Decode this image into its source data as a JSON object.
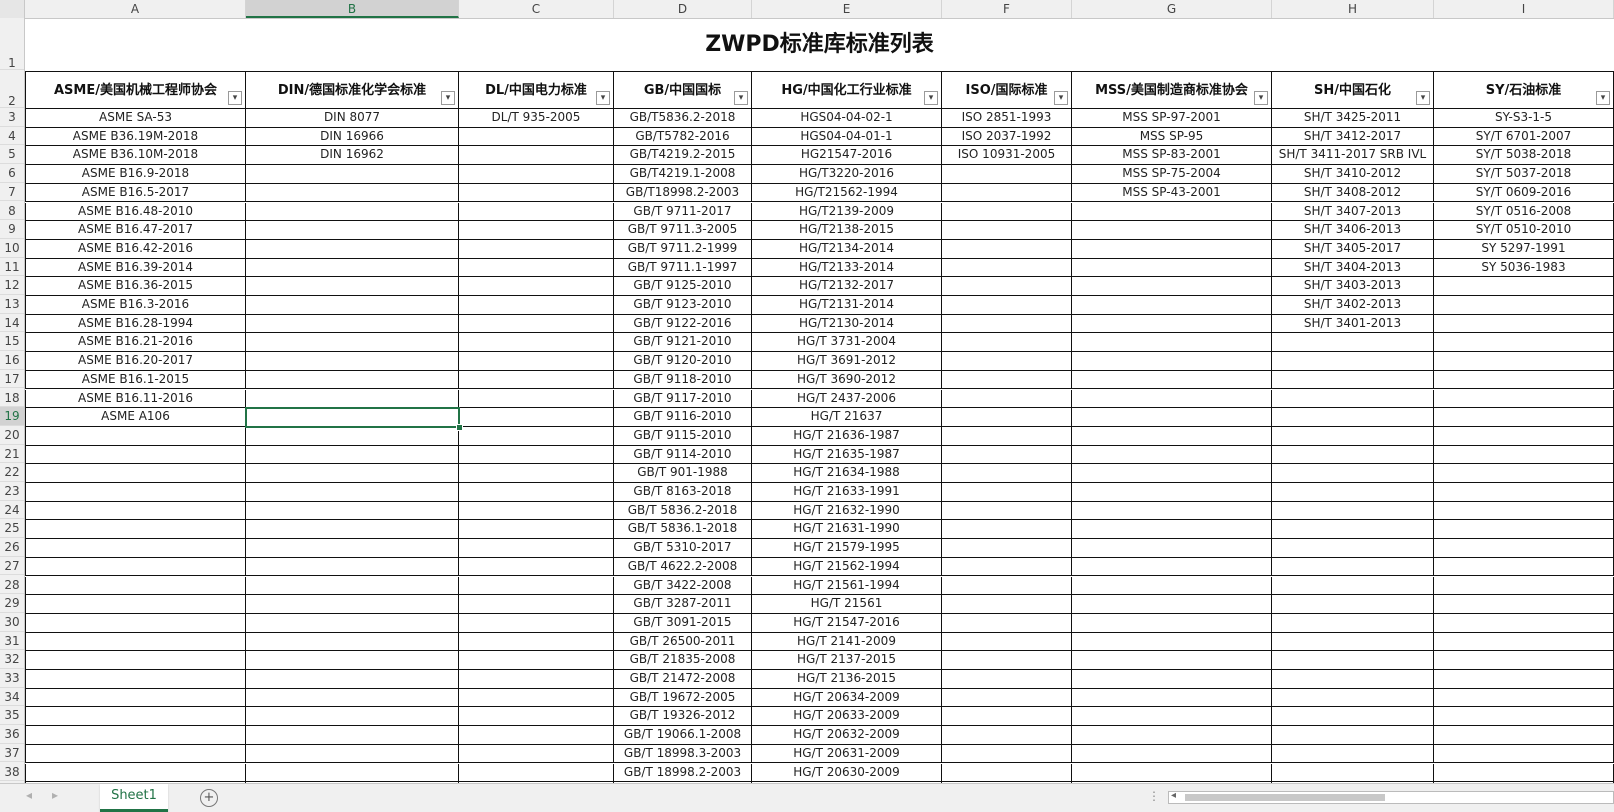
{
  "sheet": {
    "title": "ZWPD标准库标准列表",
    "col_letters": [
      "A",
      "B",
      "C",
      "D",
      "E",
      "F",
      "G",
      "H",
      "I"
    ],
    "selected_col": "B",
    "selected_row": 19,
    "row_numbers": [
      1,
      2,
      3,
      4,
      5,
      6,
      7,
      8,
      9,
      10,
      11,
      12,
      13,
      14,
      15,
      16,
      17,
      18,
      19,
      20,
      21,
      22,
      23,
      24,
      25,
      26,
      27,
      28,
      29,
      30,
      31,
      32,
      33,
      34,
      35,
      36,
      37,
      38
    ],
    "headers": [
      "ASME/美国机械工程师协会",
      "DIN/德国标准化学会标准",
      "DL/中国电力标准",
      "GB/中国国标",
      "HG/中国化工行业标准",
      "ISO/国际标准",
      "MSS/美国制造商标准协会",
      "SH/中国石化",
      "SY/石油标准"
    ],
    "columns": [
      [
        "ASME SA-53",
        "ASME B36.19M-2018",
        "ASME B36.10M-2018",
        "ASME B16.9-2018",
        "ASME B16.5-2017",
        "ASME B16.48-2010",
        "ASME B16.47-2017",
        "ASME B16.42-2016",
        "ASME B16.39-2014",
        "ASME B16.36-2015",
        "ASME B16.3-2016",
        "ASME B16.28-1994",
        "ASME B16.21-2016",
        "ASME B16.20-2017",
        "ASME B16.1-2015",
        "ASME B16.11-2016",
        "ASME A106"
      ],
      [
        "DIN 8077",
        "DIN 16966",
        "DIN 16962"
      ],
      [
        "DL/T 935-2005"
      ],
      [
        "GB/T5836.2-2018",
        "GB/T5782-2016",
        "GB/T4219.2-2015",
        "GB/T4219.1-2008",
        "GB/T18998.2-2003",
        "GB/T 9711-2017",
        "GB/T 9711.3-2005",
        "GB/T 9711.2-1999",
        "GB/T 9711.1-1997",
        "GB/T 9125-2010",
        "GB/T 9123-2010",
        "GB/T 9122-2016",
        "GB/T 9121-2010",
        "GB/T 9120-2010",
        "GB/T 9118-2010",
        "GB/T 9117-2010",
        "GB/T 9116-2010",
        "GB/T 9115-2010",
        "GB/T 9114-2010",
        "GB/T 901-1988",
        "GB/T 8163-2018",
        "GB/T 5836.2-2018",
        "GB/T 5836.1-2018",
        "GB/T 5310-2017",
        "GB/T 4622.2-2008",
        "GB/T 3422-2008",
        "GB/T 3287-2011",
        "GB/T 3091-2015",
        "GB/T 26500-2011",
        "GB/T 21835-2008",
        "GB/T 21472-2008",
        "GB/T 19672-2005",
        "GB/T 19326-2012",
        "GB/T 19066.1-2008",
        "GB/T 18998.3-2003",
        "GB/T 18998.2-2003"
      ],
      [
        "HGS04-04-02-1",
        "HGS04-04-01-1",
        "HG21547-2016",
        "HG/T3220-2016",
        "HG/T21562-1994",
        "HG/T2139-2009",
        "HG/T2138-2015",
        "HG/T2134-2014",
        "HG/T2133-2014",
        "HG/T2132-2017",
        "HG/T2131-2014",
        "HG/T2130-2014",
        "HG/T 3731-2004",
        "HG/T 3691-2012",
        "HG/T 3690-2012",
        "HG/T 2437-2006",
        "HG/T 21637",
        "HG/T 21636-1987",
        "HG/T 21635-1987",
        "HG/T 21634-1988",
        "HG/T 21633-1991",
        "HG/T 21632-1990",
        "HG/T 21631-1990",
        "HG/T 21579-1995",
        "HG/T 21562-1994",
        "HG/T 21561-1994",
        "HG/T 21561",
        "HG/T 21547-2016",
        "HG/T 2141-2009",
        "HG/T 2137-2015",
        "HG/T 2136-2015",
        "HG/T 20634-2009",
        "HG/T 20633-2009",
        "HG/T 20632-2009",
        "HG/T 20631-2009",
        "HG/T 20630-2009"
      ],
      [
        "ISO 2851-1993",
        "ISO 2037-1992",
        "ISO 10931-2005"
      ],
      [
        "MSS SP-97-2001",
        "MSS SP-95",
        "MSS SP-83-2001",
        "MSS SP-75-2004",
        "MSS SP-43-2001"
      ],
      [
        "SH/T 3425-2011",
        "SH/T 3412-2017",
        "SH/T 3411-2017 SRB IVL",
        "SH/T 3410-2012",
        "SH/T 3408-2012",
        "SH/T 3407-2013",
        "SH/T 3406-2013",
        "SH/T 3405-2017",
        "SH/T 3404-2013",
        "SH/T 3403-2013",
        "SH/T 3402-2013",
        "SH/T 3401-2013"
      ],
      [
        "SY-S3-1-5",
        "SY/T 6701-2007",
        "SY/T 5038-2018",
        "SY/T 5037-2018",
        "SY/T 0609-2016",
        "SY/T 0516-2008",
        "SY/T 0510-2010",
        "SY 5297-1991",
        "SY 5036-1983"
      ]
    ]
  },
  "tabs": {
    "sheet1": "Sheet1",
    "add": "+"
  },
  "colors": {
    "accent": "#217346"
  }
}
